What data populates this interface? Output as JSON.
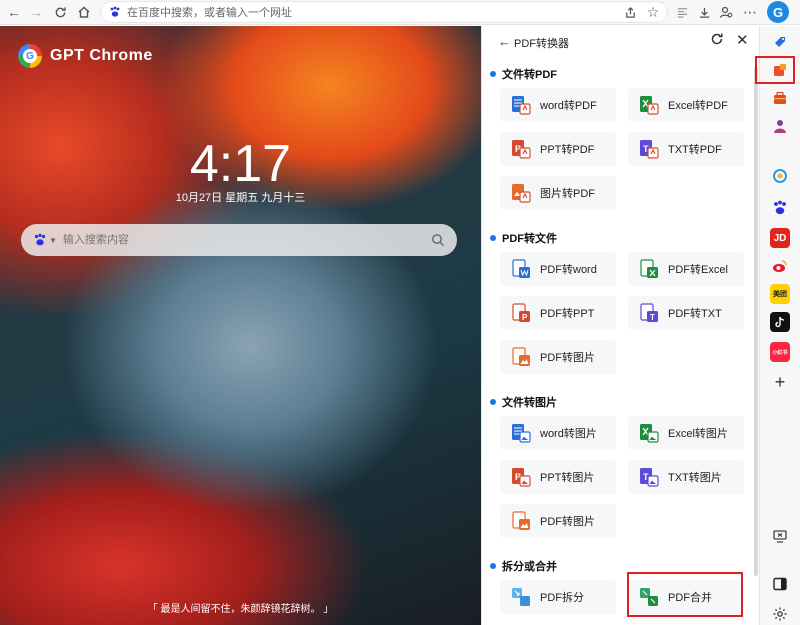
{
  "toolbar": {
    "address_placeholder": "在百度中搜索，或者输入一个网址"
  },
  "newtab": {
    "brand": "GPT Chrome",
    "brand_logo_letter": "G",
    "time": "4:17",
    "date": "10月27日 星期五 九月十三",
    "search_placeholder": "输入搜索内容",
    "quote": "「 最是人间留不住，朱颜辞镜花辞树。 」"
  },
  "panel": {
    "title": "PDF转换器",
    "sections": [
      {
        "title": "文件转PDF",
        "items": [
          "word转PDF",
          "Excel转PDF",
          "PPT转PDF",
          "TXT转PDF",
          "图片转PDF"
        ]
      },
      {
        "title": "PDF转文件",
        "items": [
          "PDF转word",
          "PDF转Excel",
          "PDF转PPT",
          "PDF转TXT",
          "PDF转图片"
        ]
      },
      {
        "title": "文件转图片",
        "items": [
          "word转图片",
          "Excel转图片",
          "PPT转图片",
          "TXT转图片",
          "PDF转图片"
        ]
      },
      {
        "title": "拆分或合并",
        "items": [
          "PDF拆分",
          "PDF合并"
        ]
      }
    ]
  },
  "sidebar_icons": [
    "bookmark-icon",
    "office-icon",
    "toolbox-icon",
    "user-icon",
    "cloud-icon",
    "baidu-icon",
    "jd-icon",
    "weibo-icon",
    "meituan-icon",
    "tiktok-icon",
    "xiaohongshu-icon",
    "add-icon",
    "screen-icon",
    "sidebar-toggle-icon",
    "settings-icon"
  ],
  "sidebar_labels": {
    "jd": "JD",
    "meituan": "美团",
    "xiaohongshu": "小红书"
  },
  "colors": {
    "accent": "#1a73e8",
    "highlight": "#e02020",
    "word": "#2b6fd6",
    "excel": "#1e8e3e",
    "ppt": "#d84a2f",
    "txt": "#5b4bd8",
    "image": "#e86a2a"
  }
}
